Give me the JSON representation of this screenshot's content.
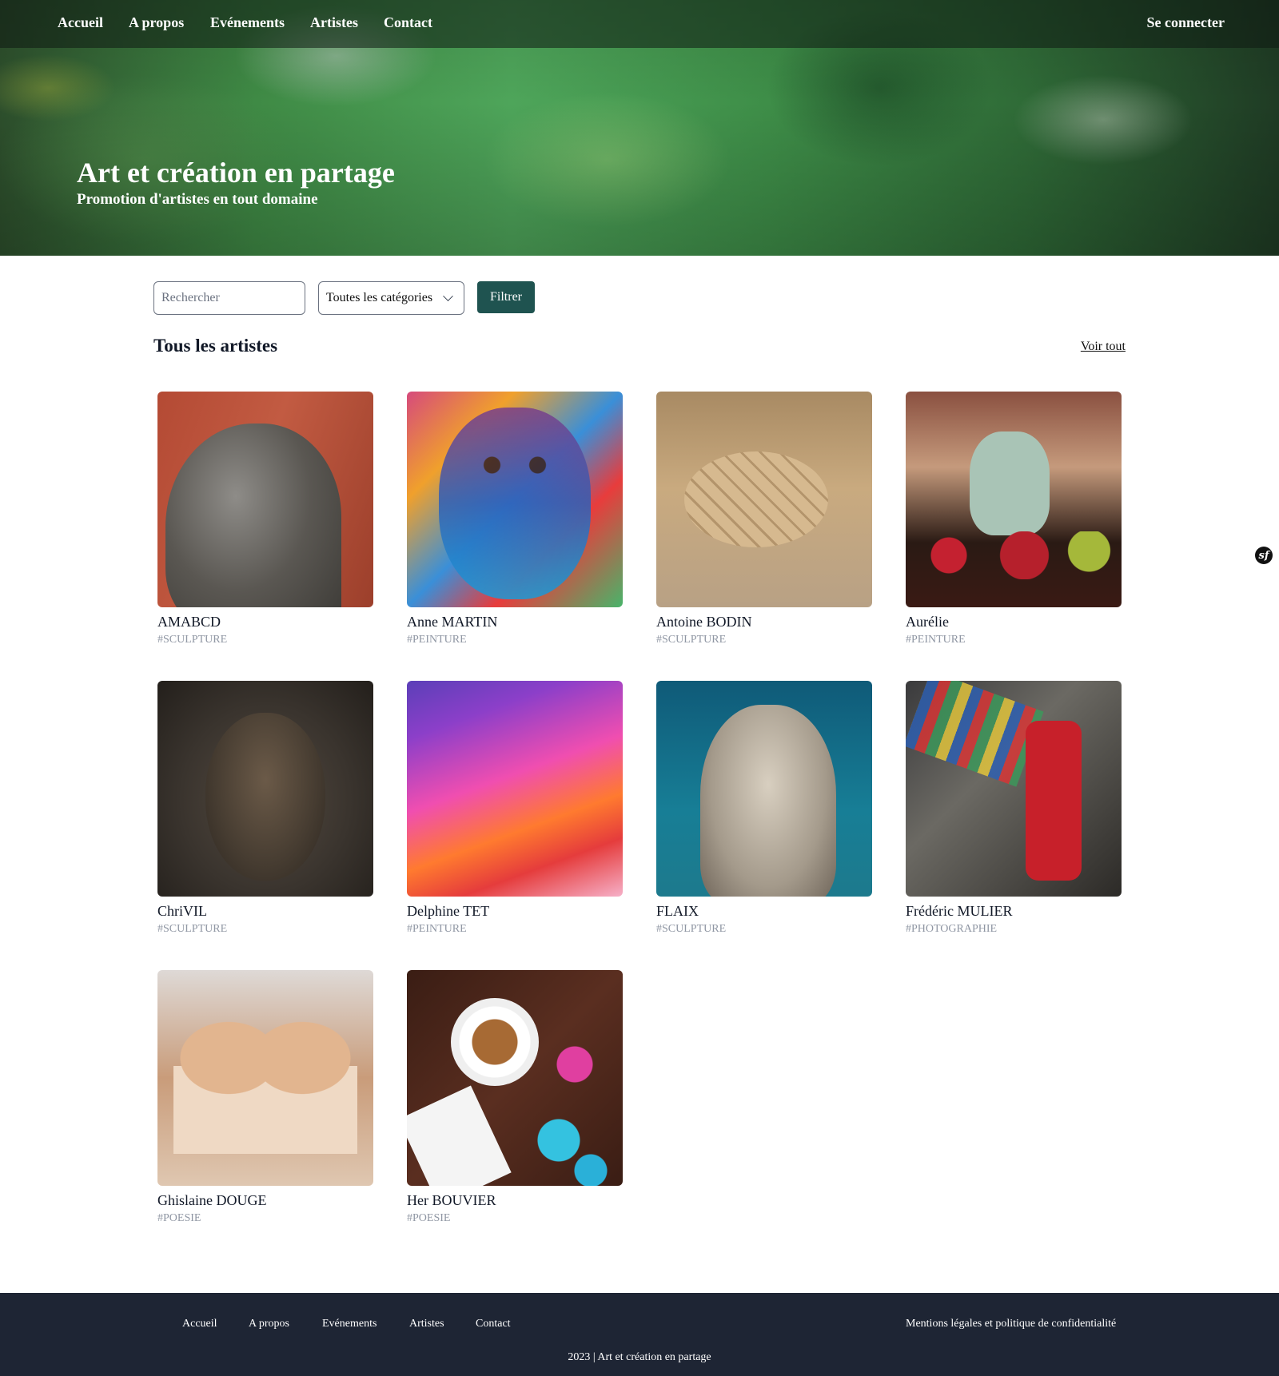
{
  "nav": {
    "items": [
      "Accueil",
      "A propos",
      "Evénements",
      "Artistes",
      "Contact"
    ],
    "login": "Se connecter"
  },
  "hero": {
    "title": "Art et création en partage",
    "subtitle": "Promotion d'artistes en tout domaine"
  },
  "filters": {
    "search_placeholder": "Rechercher",
    "category_selected": "Toutes les catégories",
    "filter_button": "Filtrer"
  },
  "section": {
    "title": "Tous les artistes",
    "see_all": "Voir tout"
  },
  "artists": [
    {
      "name": "AMABCD",
      "tag": "#SCULPTURE"
    },
    {
      "name": "Anne MARTIN",
      "tag": "#PEINTURE"
    },
    {
      "name": "Antoine BODIN",
      "tag": "#SCULPTURE"
    },
    {
      "name": "Aurélie",
      "tag": "#PEINTURE"
    },
    {
      "name": "ChriVIL",
      "tag": "#SCULPTURE"
    },
    {
      "name": "Delphine TET",
      "tag": "#PEINTURE"
    },
    {
      "name": "FLAIX",
      "tag": "#SCULPTURE"
    },
    {
      "name": "Frédéric MULIER",
      "tag": "#PHOTOGRAPHIE"
    },
    {
      "name": "Ghislaine DOUGE",
      "tag": "#POESIE"
    },
    {
      "name": "Her BOUVIER",
      "tag": "#POESIE"
    }
  ],
  "footer": {
    "links": [
      "Accueil",
      "A propos",
      "Evénements",
      "Artistes",
      "Contact"
    ],
    "legal": "Mentions légales et politique de confidentialité",
    "copyright": "2023 | Art et création en partage"
  },
  "colors": {
    "accent": "#1f5350",
    "footer_bg": "#1e2534",
    "tag": "#8f96a3"
  },
  "icons": {
    "dropdown": "chevron-down-icon",
    "debug_toolbar": "symfony-icon"
  }
}
